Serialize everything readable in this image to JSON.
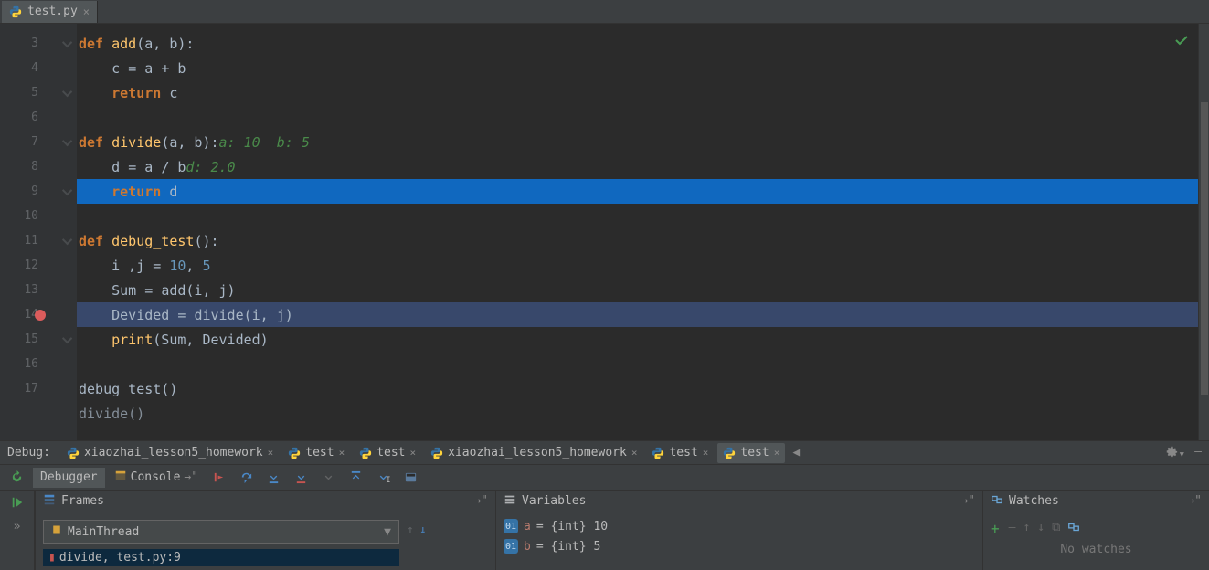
{
  "editor": {
    "tab": {
      "label": "test.py"
    },
    "first_line": 3,
    "lines": [
      {
        "n": 3,
        "fold": true,
        "type": "code",
        "html": "<span class='kw'>def </span><span class='fn'>add</span><span class='pr'>(a, b):</span>"
      },
      {
        "n": 4,
        "fold": false,
        "type": "code",
        "html": "<span class='ws'>    </span><span class='id'>c </span><span class='op'>= </span><span class='id'>a </span><span class='op'>+ </span><span class='id'>b</span>"
      },
      {
        "n": 5,
        "fold": true,
        "type": "code",
        "html": "<span class='ws'>    </span><span class='kw'>return </span><span class='id'>c</span>"
      },
      {
        "n": 6,
        "fold": false,
        "type": "blank",
        "html": ""
      },
      {
        "n": 7,
        "fold": true,
        "type": "code",
        "html": "<span class='kw'>def </span><span class='fn'>divide</span><span class='pr'>(a, b):</span>   <span class='cmv'>a: 10  b: 5</span>"
      },
      {
        "n": 8,
        "fold": false,
        "type": "code",
        "html": "<span class='ws'>    </span><span class='id'>d </span><span class='op'>= </span><span class='id'>a </span><span class='op'>/ </span><span class='id'>b</span>   <span class='cmv'>d: 2.0</span>"
      },
      {
        "n": 9,
        "fold": true,
        "type": "exec",
        "html": "<span class='ws'>    </span><span class='kw'>return </span><span class='id'>d</span>"
      },
      {
        "n": 10,
        "fold": false,
        "type": "blank",
        "html": ""
      },
      {
        "n": 11,
        "fold": true,
        "type": "code",
        "html": "<span class='kw'>def </span><span class='fn'>debug_test</span><span class='pr'>():</span>"
      },
      {
        "n": 12,
        "fold": false,
        "type": "code",
        "html": "<span class='ws'>    </span><span class='id'>i ,j </span><span class='op'>= </span><span class='nm'>10</span><span class='op'>, </span><span class='nm'>5</span>"
      },
      {
        "n": 13,
        "fold": false,
        "type": "code",
        "html": "<span class='ws'>    </span><span class='id'>Sum </span><span class='op'>= </span><span class='id'>add(i, j)</span>"
      },
      {
        "n": 14,
        "fold": false,
        "type": "bp",
        "html": "<span class='ws'>    </span><span class='id'>Devided </span><span class='op'>= </span><span class='id'>divide(i, j)</span>"
      },
      {
        "n": 15,
        "fold": true,
        "type": "code",
        "html": "<span class='ws'>    </span><span class='fn'>print</span><span class='pr'>(Sum, Devided)</span>"
      },
      {
        "n": 16,
        "fold": false,
        "type": "blank",
        "html": ""
      },
      {
        "n": 17,
        "fold": false,
        "type": "code",
        "html": "<span class='id'>debug test()</span>"
      }
    ],
    "completion_hint": "divide()"
  },
  "debug": {
    "label": "Debug:",
    "tabs": [
      {
        "label": "xiaozhai_lesson5_homework",
        "active": false
      },
      {
        "label": "test",
        "active": false
      },
      {
        "label": "test",
        "active": false
      },
      {
        "label": "xiaozhai_lesson5_homework",
        "active": false
      },
      {
        "label": "test",
        "active": false
      },
      {
        "label": "test",
        "active": true
      }
    ],
    "debugger_tab": "Debugger",
    "console_tab": "Console",
    "frames": {
      "title": "Frames",
      "thread": "MainThread",
      "stack": "divide, test.py:9"
    },
    "variables": {
      "title": "Variables",
      "vars": [
        {
          "name": "a",
          "val": "= {int} 10"
        },
        {
          "name": "b",
          "val": "= {int} 5"
        }
      ]
    },
    "watches": {
      "title": "Watches",
      "empty": "No watches"
    }
  }
}
